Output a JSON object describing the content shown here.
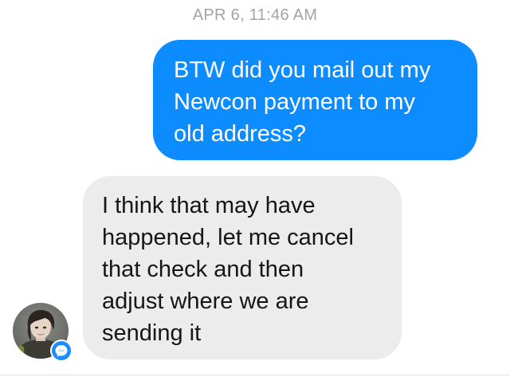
{
  "timestamp": "APR 6, 11:46 AM",
  "messages": [
    {
      "direction": "outgoing",
      "lines": [
        "BTW did you mail out my",
        "Newcon payment to my",
        "old address?"
      ]
    },
    {
      "direction": "incoming",
      "lines": [
        "I think that may have",
        "happened, let me cancel",
        "that check and then",
        "adjust where we are",
        "sending it"
      ]
    }
  ],
  "contact": {
    "avatar_icon": "contact-avatar",
    "badge_icon": "messenger-icon"
  },
  "colors": {
    "outgoing_bubble": "#0d8cff",
    "incoming_bubble": "#ececec",
    "timestamp_text": "#a3a3a8",
    "messenger_badge": "#1a8cff"
  }
}
